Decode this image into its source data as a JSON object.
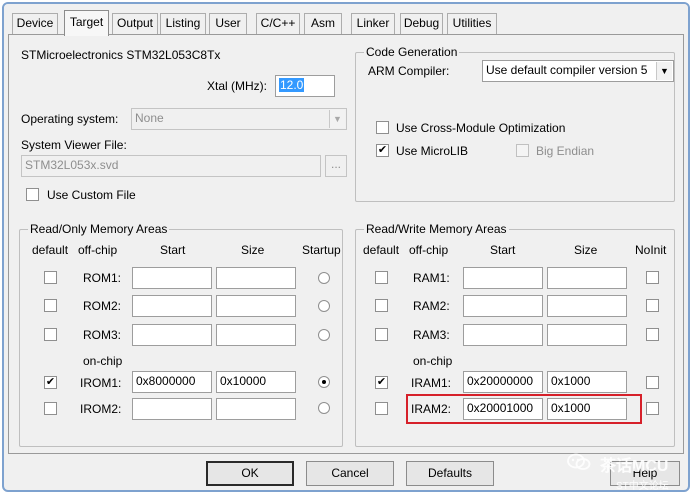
{
  "tabs": [
    "Device",
    "Target",
    "Output",
    "Listing",
    "User",
    "C/C++",
    "Asm",
    "Linker",
    "Debug",
    "Utilities"
  ],
  "active_tab": "Target",
  "device_name": "STMicroelectronics STM32L053C8Tx",
  "xtal": {
    "label": "Xtal (MHz):",
    "value": "12.0"
  },
  "os": {
    "label": "Operating system:",
    "value": "None"
  },
  "svd": {
    "label": "System Viewer File:",
    "value": "STM32L053x.svd",
    "browse": "...",
    "custom_label": "Use Custom File"
  },
  "codegen": {
    "title": "Code Generation",
    "compiler_label": "ARM Compiler:",
    "compiler_value": "Use default compiler version 5",
    "cross_module": "Use Cross-Module Optimization",
    "microlib": "Use MicroLIB",
    "big_endian": "Big Endian"
  },
  "rom_area": {
    "title": "Read/Only Memory Areas",
    "headers": {
      "default": "default",
      "offchip": "off-chip",
      "start": "Start",
      "size": "Size",
      "startup": "Startup"
    },
    "onchip_label": "on-chip",
    "rows": [
      {
        "label": "ROM1:",
        "start": "",
        "size": "",
        "default": false,
        "startup": false
      },
      {
        "label": "ROM2:",
        "start": "",
        "size": "",
        "default": false,
        "startup": false
      },
      {
        "label": "ROM3:",
        "start": "",
        "size": "",
        "default": false,
        "startup": false
      },
      {
        "label": "IROM1:",
        "start": "0x8000000",
        "size": "0x10000",
        "default": true,
        "startup": true
      },
      {
        "label": "IROM2:",
        "start": "",
        "size": "",
        "default": false,
        "startup": false
      }
    ]
  },
  "ram_area": {
    "title": "Read/Write Memory Areas",
    "headers": {
      "default": "default",
      "offchip": "off-chip",
      "start": "Start",
      "size": "Size",
      "noinit": "NoInit"
    },
    "onchip_label": "on-chip",
    "rows": [
      {
        "label": "RAM1:",
        "start": "",
        "size": "",
        "default": false,
        "noinit": false
      },
      {
        "label": "RAM2:",
        "start": "",
        "size": "",
        "default": false,
        "noinit": false
      },
      {
        "label": "RAM3:",
        "start": "",
        "size": "",
        "default": false,
        "noinit": false
      },
      {
        "label": "IRAM1:",
        "start": "0x20000000",
        "size": "0x1000",
        "default": true,
        "noinit": false
      },
      {
        "label": "IRAM2:",
        "start": "0x20001000",
        "size": "0x1000",
        "default": false,
        "noinit": false
      }
    ]
  },
  "buttons": {
    "ok": "OK",
    "cancel": "Cancel",
    "defaults": "Defaults",
    "help": "Help"
  },
  "watermark": {
    "name": "茶话MCU",
    "sub": "ST中文论坛"
  },
  "colors": {
    "highlight": "#d6202a",
    "selection": "#3399ff",
    "frame": "#7ea2cf"
  },
  "icons": {
    "check": "✔",
    "dropdown": "▼"
  }
}
